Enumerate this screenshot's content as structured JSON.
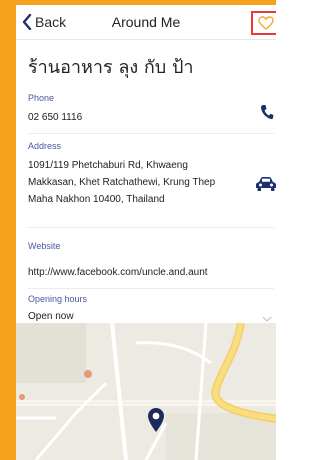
{
  "header": {
    "back_label": "Back",
    "title": "Around Me"
  },
  "place": {
    "name": "ร้านอาหาร ลุง กับ ป้า"
  },
  "details": {
    "phone": {
      "label": "Phone",
      "value": "02 650 1116"
    },
    "address": {
      "label": "Address",
      "lines": [
        "1091/119 Phetchaburi Rd, Khwaeng",
        "Makkasan, Khet Ratchathewi, Krung Thep",
        "Maha Nakhon 10400, Thailand"
      ]
    },
    "website": {
      "label": "Website",
      "value": "http://www.facebook.com/uncle.and.aunt"
    },
    "hours": {
      "label": "Opening hours",
      "value": "Open now"
    }
  },
  "icons": {
    "back": "chevron-left-icon",
    "favorite": "heart-outline-icon",
    "phone": "phone-icon",
    "directions": "car-icon",
    "expand": "chevron-down-icon",
    "marker": "map-marker-icon"
  },
  "colors": {
    "frame": "#f5a31f",
    "label": "#4b57a3",
    "highlight": "#e83a3a",
    "icon": "#1d2f6f",
    "marker": "#1e2a5c"
  }
}
